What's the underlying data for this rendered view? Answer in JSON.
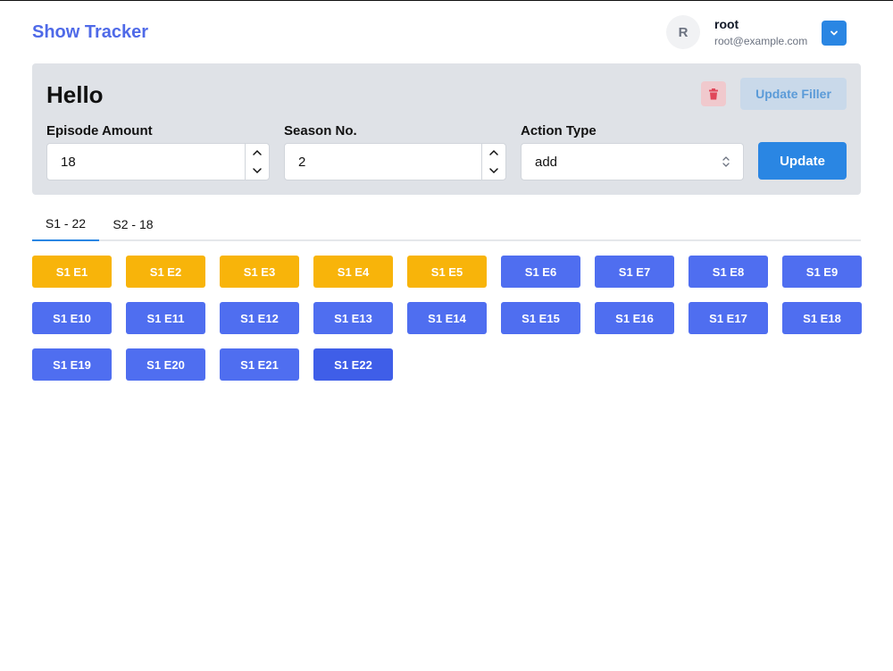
{
  "header": {
    "brand": "Show Tracker",
    "user": {
      "initial": "R",
      "name": "root",
      "email": "root@example.com"
    }
  },
  "panel": {
    "title": "Hello",
    "filler_label": "Update Filler",
    "update_label": "Update",
    "fields": {
      "episode_amount": {
        "label": "Episode Amount",
        "value": "18"
      },
      "season_no": {
        "label": "Season No.",
        "value": "2"
      },
      "action_type": {
        "label": "Action Type",
        "value": "add"
      }
    }
  },
  "tabs": [
    {
      "label": "S1 - 22",
      "active": true
    },
    {
      "label": "S2 - 18",
      "active": false
    }
  ],
  "colors": {
    "brand": "#4f6ae8",
    "primary": "#2a86e3",
    "episode": "#4f6ef0",
    "watched": "#f8b40a"
  },
  "episodes": [
    {
      "label": "S1 E1",
      "watched": true
    },
    {
      "label": "S1 E2",
      "watched": true
    },
    {
      "label": "S1 E3",
      "watched": true
    },
    {
      "label": "S1 E4",
      "watched": true
    },
    {
      "label": "S1 E5",
      "watched": true
    },
    {
      "label": "S1 E6",
      "watched": false
    },
    {
      "label": "S1 E7",
      "watched": false
    },
    {
      "label": "S1 E8",
      "watched": false
    },
    {
      "label": "S1 E9",
      "watched": false
    },
    {
      "label": "S1 E10",
      "watched": false
    },
    {
      "label": "S1 E11",
      "watched": false
    },
    {
      "label": "S1 E12",
      "watched": false
    },
    {
      "label": "S1 E13",
      "watched": false
    },
    {
      "label": "S1 E14",
      "watched": false
    },
    {
      "label": "S1 E15",
      "watched": false
    },
    {
      "label": "S1 E16",
      "watched": false
    },
    {
      "label": "S1 E17",
      "watched": false
    },
    {
      "label": "S1 E18",
      "watched": false
    },
    {
      "label": "S1 E19",
      "watched": false
    },
    {
      "label": "S1 E20",
      "watched": false
    },
    {
      "label": "S1 E21",
      "watched": false
    },
    {
      "label": "S1 E22",
      "watched": false,
      "hovered": true
    }
  ]
}
